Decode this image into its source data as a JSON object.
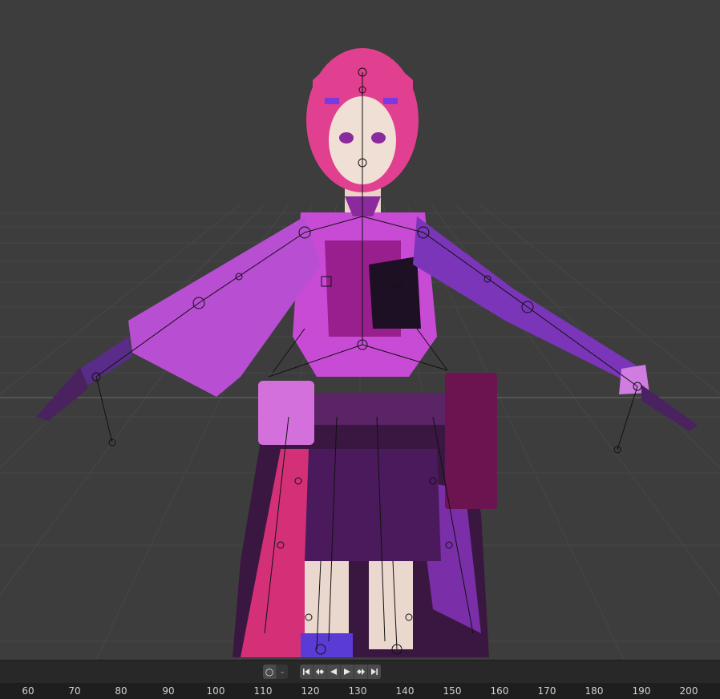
{
  "viewport": {
    "name": "3D Viewport",
    "subject": "rigged anime character model with armature bones"
  },
  "timeline": {
    "keying": {
      "icon": "keyframe-record-icon",
      "dropdown_icon": "chevron-down-icon"
    },
    "playback": [
      {
        "name": "jump-to-start",
        "icon": "jump-start-icon"
      },
      {
        "name": "previous-keyframe",
        "icon": "prev-keyframe-icon"
      },
      {
        "name": "play-reverse",
        "icon": "play-reverse-icon"
      },
      {
        "name": "play",
        "icon": "play-icon"
      },
      {
        "name": "next-keyframe",
        "icon": "next-keyframe-icon"
      },
      {
        "name": "jump-to-end",
        "icon": "jump-end-icon"
      }
    ],
    "ruler_ticks": [
      "60",
      "70",
      "80",
      "90",
      "100",
      "110",
      "120",
      "130",
      "140",
      "150",
      "160",
      "170",
      "180",
      "190",
      "200"
    ]
  },
  "colors": {
    "viewport_bg": "#3d3d3d",
    "grid_line": "#4a4a4a",
    "timeline_bg": "#282828",
    "ruler_bg": "#1e1e1e",
    "character_primary": "#c84bd6",
    "character_dark": "#5a1f6e",
    "character_hair": "#e0408f"
  }
}
